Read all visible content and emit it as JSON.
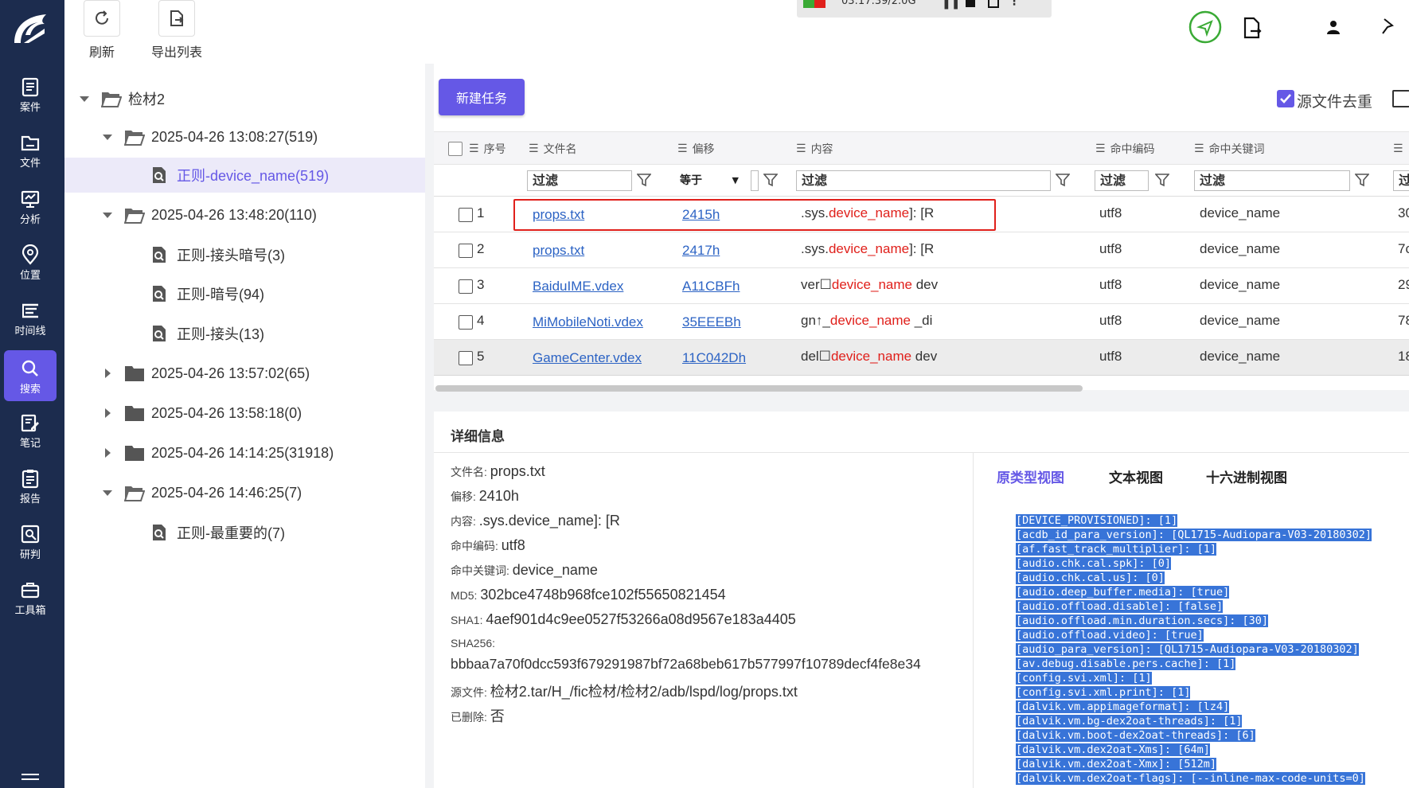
{
  "toolbar": {
    "refresh_label": "刷新",
    "export_label": "导出列表",
    "media_text": "03:17:39/2.0G"
  },
  "nav": {
    "items": [
      {
        "label": "案件",
        "icon": "case-icon"
      },
      {
        "label": "文件",
        "icon": "folder-icon"
      },
      {
        "label": "分析",
        "icon": "analysis-icon"
      },
      {
        "label": "位置",
        "icon": "location-icon"
      },
      {
        "label": "时间线",
        "icon": "timeline-icon"
      },
      {
        "label": "搜索",
        "icon": "search-icon"
      },
      {
        "label": "笔记",
        "icon": "note-icon"
      },
      {
        "label": "报告",
        "icon": "report-icon"
      },
      {
        "label": "研判",
        "icon": "judge-icon"
      },
      {
        "label": "工具箱",
        "icon": "toolbox-icon"
      }
    ],
    "active": "搜索"
  },
  "tree": {
    "root": "检材2",
    "nodes": [
      {
        "label": "2025-04-26 13:08:27(519)"
      },
      {
        "label": "正则-device_name(519)"
      },
      {
        "label": "2025-04-26 13:48:20(110)"
      },
      {
        "label": "正则-接头暗号(3)"
      },
      {
        "label": "正则-暗号(94)"
      },
      {
        "label": "正则-接头(13)"
      },
      {
        "label": "2025-04-26 13:57:02(65)"
      },
      {
        "label": "2025-04-26 13:58:18(0)"
      },
      {
        "label": "2025-04-26 14:14:25(31918)"
      },
      {
        "label": "2025-04-26 14:46:25(7)"
      },
      {
        "label": "正则-最重要的(7)"
      }
    ]
  },
  "grid": {
    "new_task_label": "新建任务",
    "dedupe_label": "源文件去重",
    "columns": [
      "序号",
      "文件名",
      "偏移",
      "内容",
      "命中编码",
      "命中关键词"
    ],
    "filter_placeholder": "过滤",
    "offset_filter_mode": "等于",
    "overflow_filter": "过",
    "rows": [
      {
        "index": "1",
        "file": "props.txt",
        "offset": "2415h",
        "pre": ".sys.",
        "hit": "device_name",
        "post": "]: [R",
        "encoding": "utf8",
        "keyword": "device_name",
        "extra": "30"
      },
      {
        "index": "2",
        "file": "props.txt",
        "offset": "2417h",
        "pre": ".sys.",
        "hit": "device_name",
        "post": "]: [R",
        "encoding": "utf8",
        "keyword": "device_name",
        "extra": "7c"
      },
      {
        "index": "3",
        "file": "BaiduIME.vdex",
        "offset": "A11CBFh",
        "pre": "ver☐",
        "hit": "device_name",
        "post": " dev",
        "encoding": "utf8",
        "keyword": "device_name",
        "extra": "29"
      },
      {
        "index": "4",
        "file": "MiMobileNoti.vdex",
        "offset": "35EEEBh",
        "pre": "gn↑_",
        "hit": "device_name",
        "post": " _di",
        "encoding": "utf8",
        "keyword": "device_name",
        "extra": "78"
      },
      {
        "index": "5",
        "file": "GameCenter.vdex",
        "offset": "11C042Dh",
        "pre": "del☐",
        "hit": "device_name",
        "post": " dev",
        "encoding": "utf8",
        "keyword": "device_name",
        "extra": "18"
      }
    ]
  },
  "detail": {
    "title": "详细信息",
    "file_label": "文件名:",
    "file_value": "props.txt",
    "offset_label": "偏移:",
    "offset_value": "2410h",
    "content_label": "内容:",
    "content_pre": ".sys.",
    "content_hit": "device_name",
    "content_post": "]: [R",
    "encoding_label": "命中编码:",
    "encoding_value": "utf8",
    "keyword_label": "命中关键词:",
    "keyword_value": "device_name",
    "md5_label": "MD5:",
    "md5_value": "302bce4748b968fce102f55650821454",
    "sha1_label": "SHA1:",
    "sha1_value": "4aef901d4c9ee0527f53266a08d9567e183a4405",
    "sha256_label": "SHA256:",
    "sha256_value": "bbbaa7a70f0dcc593f679291987bf72a68beb617b577997f10789decf4fe8e34",
    "source_label": "源文件:",
    "source_value": "检材2.tar/H_/fic检材/检材2/adb/lspd/log/props.txt",
    "deleted_label": "已删除:",
    "deleted_value": "否",
    "tabs": [
      "原类型视图",
      "文本视图",
      "十六进制视图"
    ],
    "raw_lines": [
      "[DEVICE_PROVISIONED]: [1]",
      "[acdb_id_para_version]: [QL1715-Audiopara-V03-20180302]",
      "[af.fast_track_multiplier]: [1]",
      "[audio.chk.cal.spk]: [0]",
      "[audio.chk.cal.us]: [0]",
      "[audio.deep_buffer.media]: [true]",
      "[audio.offload.disable]: [false]",
      "[audio.offload.min.duration.secs]: [30]",
      "[audio.offload.video]: [true]",
      "[audio_para_version]: [QL1715-Audiopara-V03-20180302]",
      "[av.debug.disable.pers.cache]: [1]",
      "[config.svi.xml]: [1]",
      "[config.svi.xml.print]: [1]",
      "[dalvik.vm.appimageformat]: [lz4]",
      "[dalvik.vm.bg-dex2oat-threads]: [1]",
      "[dalvik.vm.boot-dex2oat-threads]: [6]",
      "[dalvik.vm.dex2oat-Xms]: [64m]",
      "[dalvik.vm.dex2oat-Xmx]: [512m]",
      "[dalvik.vm.dex2oat-flags]: [--inline-max-code-units=0]"
    ]
  },
  "colors": {
    "nav_bg": "#1c2c4e",
    "accent": "#6558e6",
    "highlight": "#e0201b",
    "link": "#2c63c4"
  }
}
